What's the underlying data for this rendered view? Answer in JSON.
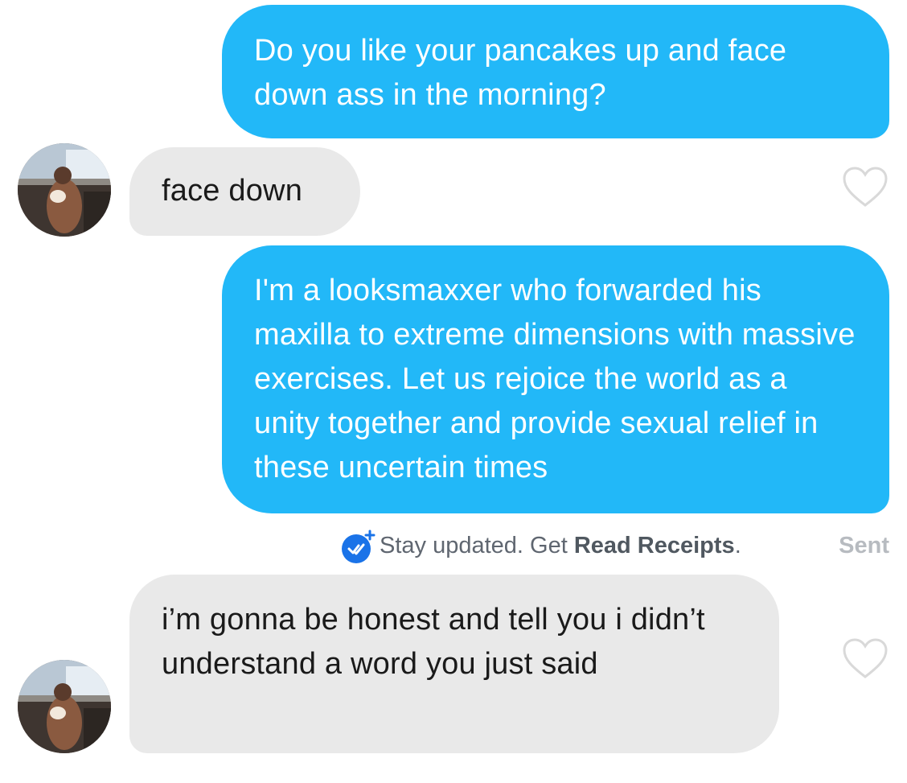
{
  "messages": [
    {
      "direction": "outgoing",
      "text": "Do you like your pancakes up and face down ass in the morning?"
    },
    {
      "direction": "incoming",
      "text": "face down",
      "liked": false
    },
    {
      "direction": "outgoing",
      "text": "I'm a looksmaxxer who forwarded his maxilla to extreme dimensions with massive exercises. Let us rejoice the world as a unity together and provide sexual relief in these uncertain times"
    },
    {
      "direction": "incoming",
      "text": "i’m gonna be honest and tell you i didn’t understand a word you just said",
      "liked": false
    }
  ],
  "receipts": {
    "prefix": "Stay updated. Get ",
    "link": "Read Receipts",
    "suffix": ".",
    "status": "Sent"
  },
  "icons": {
    "read_receipts": "double-check-icon",
    "like": "heart-outline-icon",
    "plus": "plus-icon"
  },
  "colors": {
    "outgoing_bubble": "#22b8f8",
    "incoming_bubble": "#e9e9e9",
    "receipt_badge": "#1a73e8",
    "heart_outline": "#d9d9d9"
  }
}
